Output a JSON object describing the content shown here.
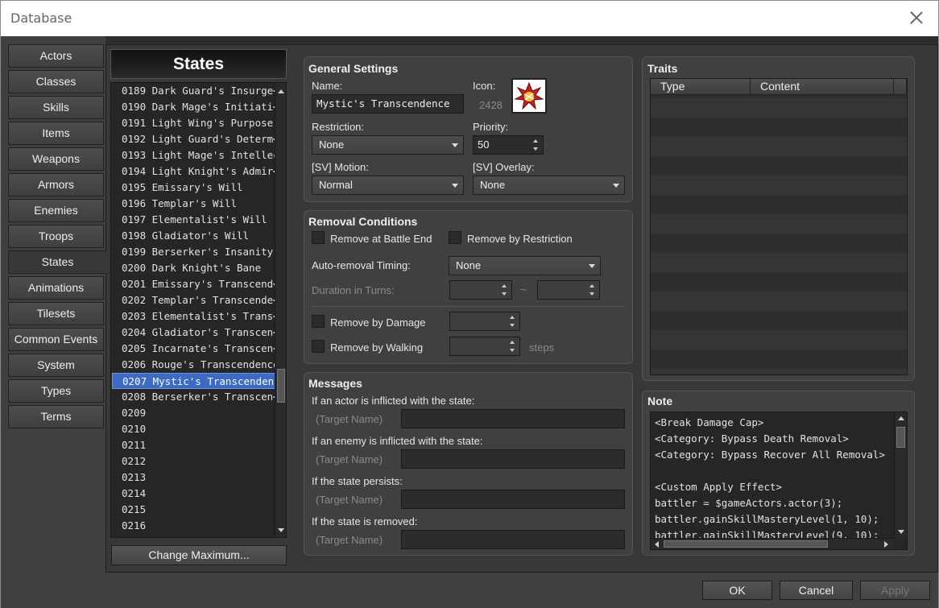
{
  "window": {
    "title": "Database"
  },
  "categories": [
    "Actors",
    "Classes",
    "Skills",
    "Items",
    "Weapons",
    "Armors",
    "Enemies",
    "Troops",
    "States",
    "Animations",
    "Tilesets",
    "Common Events",
    "System",
    "Types",
    "Terms"
  ],
  "active_category": "States",
  "list": {
    "header": "States",
    "rows": [
      "0189 Dark Guard's Insurge⋯",
      "0190 Dark Mage's Initiati⋯",
      "0191 Light Wing's Purpose",
      "0192 Light Guard's Determ⋯",
      "0193 Light Mage's Intellect",
      "0194 Light Knight's Admir⋯",
      "0195 Emissary's Will",
      "0196 Templar's Will",
      "0197 Elementalist's Will",
      "0198 Gladiator's Will",
      "0199 Berserker's Insanity",
      "0200 Dark Knight's Bane",
      "0201 Emissary's Transcend⋯",
      "0202 Templar's Transcende⋯",
      "0203 Elementalist's Trans⋯",
      "0204 Gladiator's Transcen⋯",
      "0205 Incarnate's Transcen⋯",
      "0206 Rouge's Transcendence",
      "0207 Mystic's Transcendence",
      "0208 Berserker's Transcen⋯",
      "0209",
      "0210",
      "0211",
      "0212",
      "0213",
      "0214",
      "0215",
      "0216"
    ],
    "selected": "0207 Mystic's Transcendence",
    "change_max_label": "Change Maximum..."
  },
  "general": {
    "title": "General Settings",
    "name_label": "Name:",
    "name_value": "Mystic's Transcendence",
    "icon_label": "Icon:",
    "icon_index": "2428",
    "restriction_label": "Restriction:",
    "restriction_value": "None",
    "priority_label": "Priority:",
    "priority_value": "50",
    "sv_motion_label": "[SV] Motion:",
    "sv_motion_value": "Normal",
    "sv_overlay_label": "[SV] Overlay:",
    "sv_overlay_value": "None"
  },
  "removal": {
    "title": "Removal Conditions",
    "remove_battle_end": "Remove at Battle End",
    "remove_restriction": "Remove by Restriction",
    "auto_timing_label": "Auto-removal Timing:",
    "auto_timing_value": "None",
    "duration_label": "Duration in Turns:",
    "tilde": "~",
    "remove_damage": "Remove by Damage",
    "remove_walking": "Remove by Walking",
    "steps": "steps"
  },
  "messages": {
    "title": "Messages",
    "items": [
      {
        "label": "If an actor is inflicted with the state:",
        "prefix": "(Target Name)"
      },
      {
        "label": "If an enemy is inflicted with the state:",
        "prefix": "(Target Name)"
      },
      {
        "label": "If the state persists:",
        "prefix": "(Target Name)"
      },
      {
        "label": "If the state is removed:",
        "prefix": "(Target Name)"
      }
    ]
  },
  "traits": {
    "title": "Traits",
    "columns": [
      "Type",
      "Content"
    ]
  },
  "note": {
    "title": "Note",
    "lines": [
      "<Break Damage Cap>",
      "<Category: Bypass Death Removal>",
      "<Category: Bypass Recover All Removal>",
      "",
      "<Custom Apply Effect>",
      "battler = $gameActors.actor(3);",
      "battler.gainSkillMasteryLevel(1, 10);",
      "battler.gainSkillMasteryLevel(9, 10);"
    ]
  },
  "footer": {
    "ok": "OK",
    "cancel": "Cancel",
    "apply": "Apply"
  },
  "colors": {
    "selection": "#3c6ac4",
    "background": "#383838"
  },
  "icons": {
    "close": "close-icon",
    "state_icon": "burst-icon"
  }
}
